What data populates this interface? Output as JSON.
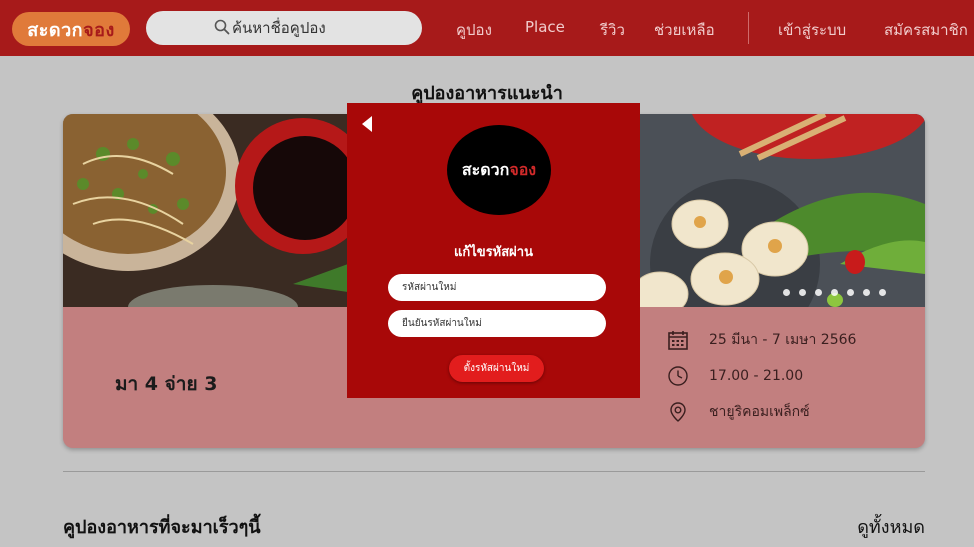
{
  "header": {
    "logo_main": "สะดวก",
    "logo_accent": "จอง",
    "search_placeholder": "ค้นหาชื่อคูปอง",
    "nav": [
      "คูปอง",
      "Place",
      "รีวิว",
      "ช่วยเหลือ"
    ],
    "login": "เข้าสู่ระบบ",
    "register": "สมัครสมาชิก"
  },
  "main": {
    "section_title": "คูปองอาหารแนะนำ",
    "promo_title": "มา 4 จ่าย 3",
    "date_range": "25 มีนา - 7 เมษา 2566",
    "time_range": "17.00 - 21.00",
    "location": "ชายูริคอมเพล็กซ์",
    "carousel_dots": 7,
    "upcoming_title": "คูปองอาหารที่จะมาเร็วๆนี้",
    "view_all": "ดูทั้งหมด"
  },
  "modal": {
    "logo_main": "สะดวก",
    "logo_accent": "จอง",
    "title": "แก้ไขรหัสผ่าน",
    "new_password_placeholder": "รหัสผ่านใหม่",
    "confirm_password_placeholder": "ยืนยันรหัสผ่านใหม่",
    "submit_label": "ตั้งรหัสผ่านใหม่"
  },
  "colors": {
    "header_bg": "#a71a1a",
    "modal_bg": "#a80808",
    "card_bg": "#c27f7f",
    "logo_bg": "#e07a3a",
    "overlay_bg": "#c4c4c4"
  }
}
